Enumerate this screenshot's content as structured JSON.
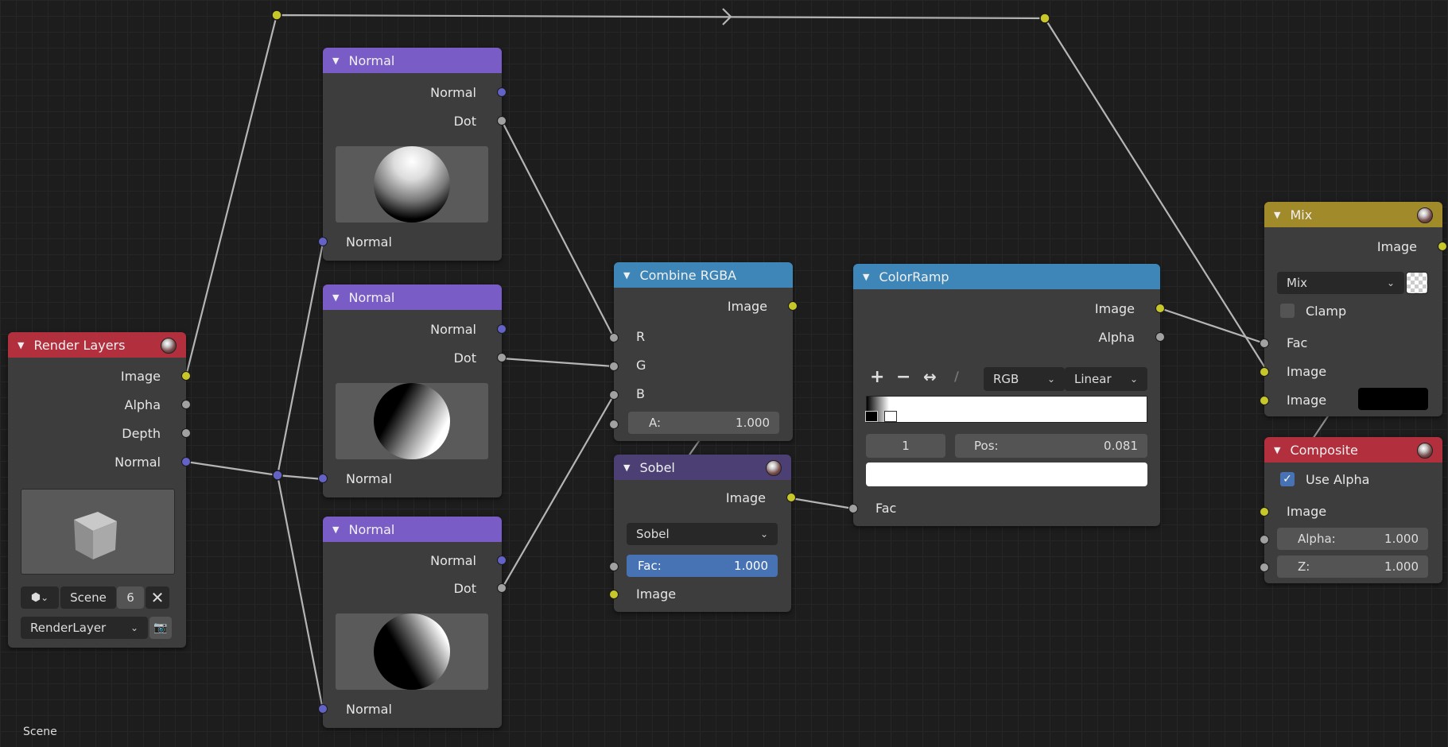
{
  "status": {
    "scene_label": "Scene"
  },
  "render_layers": {
    "title": "Render Layers",
    "outputs": [
      "Image",
      "Alpha",
      "Depth",
      "Normal"
    ],
    "scene": "Scene",
    "scene_number": "6",
    "layer": "RenderLayer"
  },
  "normal1": {
    "title": "Normal",
    "out_normal": "Normal",
    "out_dot": "Dot",
    "in_normal": "Normal"
  },
  "normal2": {
    "title": "Normal",
    "out_normal": "Normal",
    "out_dot": "Dot",
    "in_normal": "Normal"
  },
  "normal3": {
    "title": "Normal",
    "out_normal": "Normal",
    "out_dot": "Dot",
    "in_normal": "Normal"
  },
  "combine": {
    "title": "Combine RGBA",
    "out_image": "Image",
    "r": "R",
    "g": "G",
    "b": "B",
    "a_label": "A:",
    "a_value": "1.000"
  },
  "sobel": {
    "title": "Sobel",
    "out_image": "Image",
    "filter": "Sobel",
    "fac_label": "Fac:",
    "fac_value": "1.000",
    "in_image": "Image"
  },
  "colorramp": {
    "title": "ColorRamp",
    "out_image": "Image",
    "out_alpha": "Alpha",
    "color_mode": "RGB",
    "interpolation": "Linear",
    "stop_index": "1",
    "pos_label": "Pos:",
    "pos_value": "0.081",
    "in_fac": "Fac"
  },
  "mix": {
    "title": "Mix",
    "out_image": "Image",
    "blend": "Mix",
    "clamp": "Clamp",
    "fac": "Fac",
    "in_image1": "Image",
    "in_image2": "Image"
  },
  "composite": {
    "title": "Composite",
    "use_alpha": "Use Alpha",
    "in_image": "Image",
    "alpha_label": "Alpha:",
    "alpha_value": "1.000",
    "z_label": "Z:",
    "z_value": "1.000"
  },
  "colors": {
    "yellow_socket": "#c7c729",
    "gray_socket": "#a1a1a1",
    "blue_socket": "#6363c7",
    "render_header": "#b22f3e",
    "normal_header": "#7a5cc6",
    "combine_header": "#3f86b8",
    "sobel_header": "#4b3f73",
    "mix_header": "#a08a2a",
    "link": "#b5b5b5",
    "field_highlight": "#4772b3"
  },
  "icons": [
    "triangle-down-icon",
    "material-ball-icon",
    "scene-icon",
    "close-x-icon",
    "camera-icon",
    "plus-icon",
    "minus-icon",
    "flip-arrows-icon",
    "eyedropper-icon",
    "checker-icon",
    "checkmark-icon",
    "chevron-down-icon"
  ]
}
